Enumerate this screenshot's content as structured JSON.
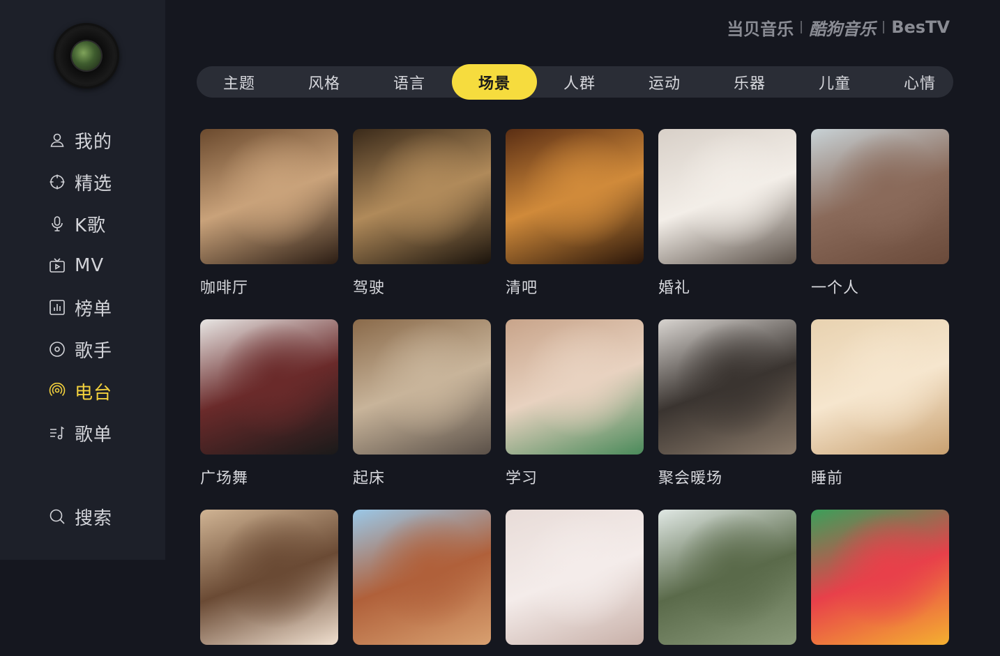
{
  "sidebar": {
    "items": [
      {
        "label": "我的",
        "icon": "user-icon"
      },
      {
        "label": "精选",
        "icon": "compass-icon"
      },
      {
        "label": "K歌",
        "icon": "microphone-icon"
      },
      {
        "label": "MV",
        "icon": "tv-icon"
      },
      {
        "label": "榜单",
        "icon": "chart-icon"
      },
      {
        "label": "歌手",
        "icon": "disc-icon"
      },
      {
        "label": "电台",
        "icon": "radio-icon",
        "active": true
      },
      {
        "label": "歌单",
        "icon": "playlist-icon"
      }
    ],
    "search": {
      "label": "搜索",
      "icon": "search-icon"
    }
  },
  "brands": [
    "当贝音乐",
    "酷狗音乐",
    "BesTV"
  ],
  "tabs": [
    "主题",
    "风格",
    "语言",
    "场景",
    "人群",
    "运动",
    "乐器",
    "儿童",
    "心情"
  ],
  "active_tab": "场景",
  "colors": {
    "accent": "#f6dc3e",
    "background": "#15171f",
    "sidebar": "#1d2029"
  },
  "cards": [
    {
      "label": "咖啡厅",
      "colors": [
        "#6b4a2e",
        "#c9a27a",
        "#2b1d14"
      ]
    },
    {
      "label": "驾驶",
      "colors": [
        "#3a2a1a",
        "#b08a5a",
        "#1a130c"
      ]
    },
    {
      "label": "清吧",
      "colors": [
        "#5a2e14",
        "#d08a3a",
        "#2a160a"
      ]
    },
    {
      "label": "婚礼",
      "colors": [
        "#d8d0c8",
        "#f3eee8",
        "#5a5048"
      ]
    },
    {
      "label": "一个人",
      "colors": [
        "#c8d2d6",
        "#8a6a5a",
        "#6a4a3a"
      ]
    },
    {
      "label": "广场舞",
      "colors": [
        "#e8e6e4",
        "#6a2a2a",
        "#1a1a1a"
      ]
    },
    {
      "label": "起床",
      "colors": [
        "#8a6a4a",
        "#c8b49a",
        "#5a5048"
      ]
    },
    {
      "label": "学习",
      "colors": [
        "#c8a48a",
        "#e8d2c0",
        "#4a8a5a"
      ]
    },
    {
      "label": "聚会暖场",
      "colors": [
        "#d8d4d0",
        "#3a3430",
        "#8a7a6a"
      ]
    },
    {
      "label": "睡前",
      "colors": [
        "#e8d2b0",
        "#f6e6ce",
        "#c8a070"
      ]
    },
    {
      "label": "",
      "colors": [
        "#d0b494",
        "#6a4a34",
        "#f0e0d0"
      ]
    },
    {
      "label": "",
      "colors": [
        "#9ac8e8",
        "#b0603a",
        "#d8a070"
      ]
    },
    {
      "label": "",
      "colors": [
        "#e8dcd8",
        "#f4ecea",
        "#c8b0a8"
      ]
    },
    {
      "label": "",
      "colors": [
        "#e0e8e4",
        "#5a6a4a",
        "#8a9a7a"
      ]
    },
    {
      "label": "",
      "colors": [
        "#3aa05a",
        "#e8404a",
        "#f4b030"
      ]
    }
  ]
}
